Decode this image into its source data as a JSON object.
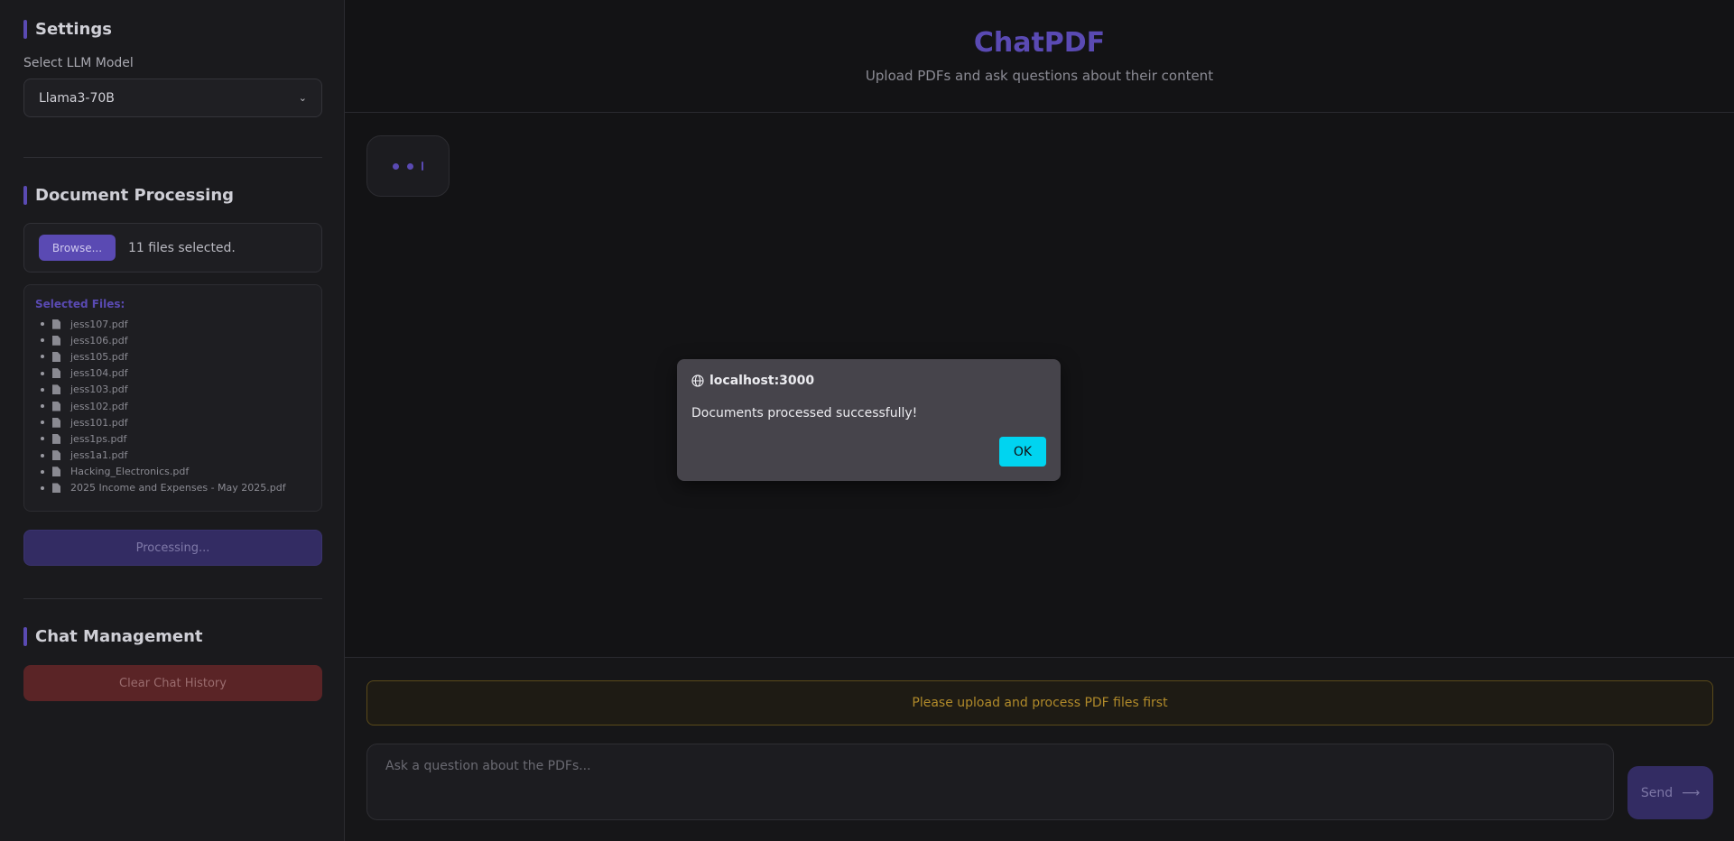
{
  "sidebar": {
    "settings": {
      "title": "Settings",
      "select_label": "Select LLM Model",
      "selected_model": "Llama3-70B"
    },
    "document_processing": {
      "title": "Document Processing",
      "browse_label": "Browse...",
      "files_count": "11 files selected.",
      "selected_files_label": "Selected Files:",
      "files": [
        "jess107.pdf",
        "jess106.pdf",
        "jess105.pdf",
        "jess104.pdf",
        "jess103.pdf",
        "jess102.pdf",
        "jess101.pdf",
        "jess1ps.pdf",
        "jess1a1.pdf",
        "Hacking_Electronics.pdf",
        "2025 Income and Expenses - May 2025.pdf"
      ],
      "process_button": "Processing..."
    },
    "chat_management": {
      "title": "Chat Management",
      "clear_button": "Clear Chat History"
    }
  },
  "main": {
    "title": "ChatPDF",
    "subtitle": "Upload PDFs and ask questions about their content",
    "warning": "Please upload and process PDF files first",
    "input_placeholder": "Ask a question about the PDFs...",
    "send_label": "Send"
  },
  "dialog": {
    "origin": "localhost:3000",
    "message": "Documents processed successfully!",
    "ok_label": "OK"
  },
  "colors": {
    "accent": "#5a4ab3",
    "danger": "#5a2426",
    "warning_text": "#b08a2a",
    "ok_button": "#00d4f0"
  }
}
